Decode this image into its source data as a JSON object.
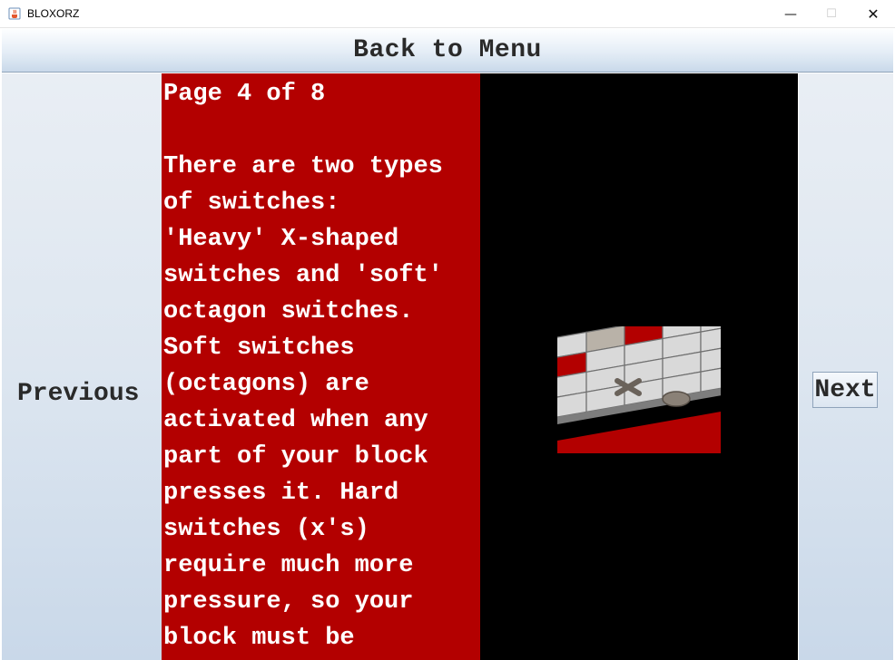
{
  "window": {
    "title": "BLOXORZ",
    "app_icon": "java-cup-icon",
    "controls": {
      "minimize": "—",
      "maximize": "☐",
      "close": "✕"
    }
  },
  "header": {
    "back_label": "Back to Menu"
  },
  "nav": {
    "previous_label": "Previous",
    "next_label": "Next"
  },
  "tutorial": {
    "page_label": "Page 4 of 8",
    "lines": [
      "There are two types",
      "of switches:",
      "'Heavy' X-shaped",
      "switches and 'soft'",
      "octagon switches.",
      "Soft switches",
      "(octagons) are",
      "activated when any",
      "part of your block",
      "presses it. Hard",
      "switches (x's)",
      "require much more",
      "pressure, so your",
      "block must be"
    ]
  },
  "preview": {
    "image": "switch-tiles-illustration",
    "colors": {
      "panel": "#b30000",
      "background": "#000000",
      "tile": "#d8d8d8",
      "switch": "#8a8177"
    }
  }
}
